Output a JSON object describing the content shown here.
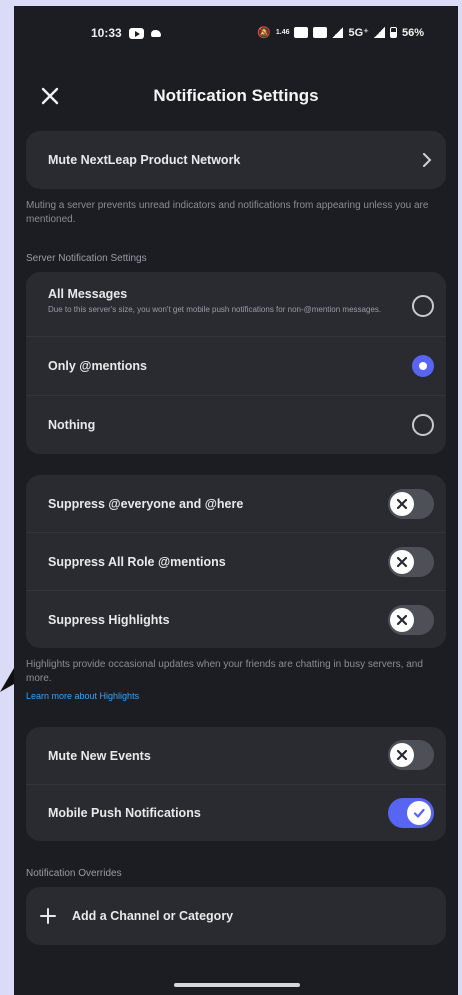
{
  "status_bar": {
    "time": "10:33",
    "right_text": "5G⁺",
    "speed": "1.46",
    "battery": "56%"
  },
  "header": {
    "title": "Notification Settings"
  },
  "mute_server": {
    "label": "Mute NextLeap Product Network",
    "help": "Muting a server prevents unread indicators and notifications from appearing unless you are mentioned."
  },
  "server_notifications": {
    "heading": "Server Notification Settings",
    "options": [
      {
        "label": "All Messages",
        "sub": "Due to this server's size, you won't get mobile push notifications for non-@mention messages.",
        "selected": false
      },
      {
        "label": "Only @mentions",
        "selected": true
      },
      {
        "label": "Nothing",
        "selected": false
      }
    ]
  },
  "suppress": {
    "items": [
      {
        "label": "Suppress @everyone and @here",
        "on": false
      },
      {
        "label": "Suppress All Role @mentions",
        "on": false
      },
      {
        "label": "Suppress Highlights",
        "on": false
      }
    ],
    "help": "Highlights provide occasional updates when your friends are chatting in busy servers, and more.",
    "link": "Learn more about Highlights"
  },
  "events": {
    "items": [
      {
        "label": "Mute New Events",
        "on": false
      },
      {
        "label": "Mobile Push Notifications",
        "on": true
      }
    ]
  },
  "overrides": {
    "heading": "Notification Overrides",
    "add_label": "Add a Channel or Category"
  },
  "colors": {
    "accent": "#5865f2",
    "background": "#1c1d22",
    "card": "#2a2b31",
    "link": "#3aa3f5"
  }
}
